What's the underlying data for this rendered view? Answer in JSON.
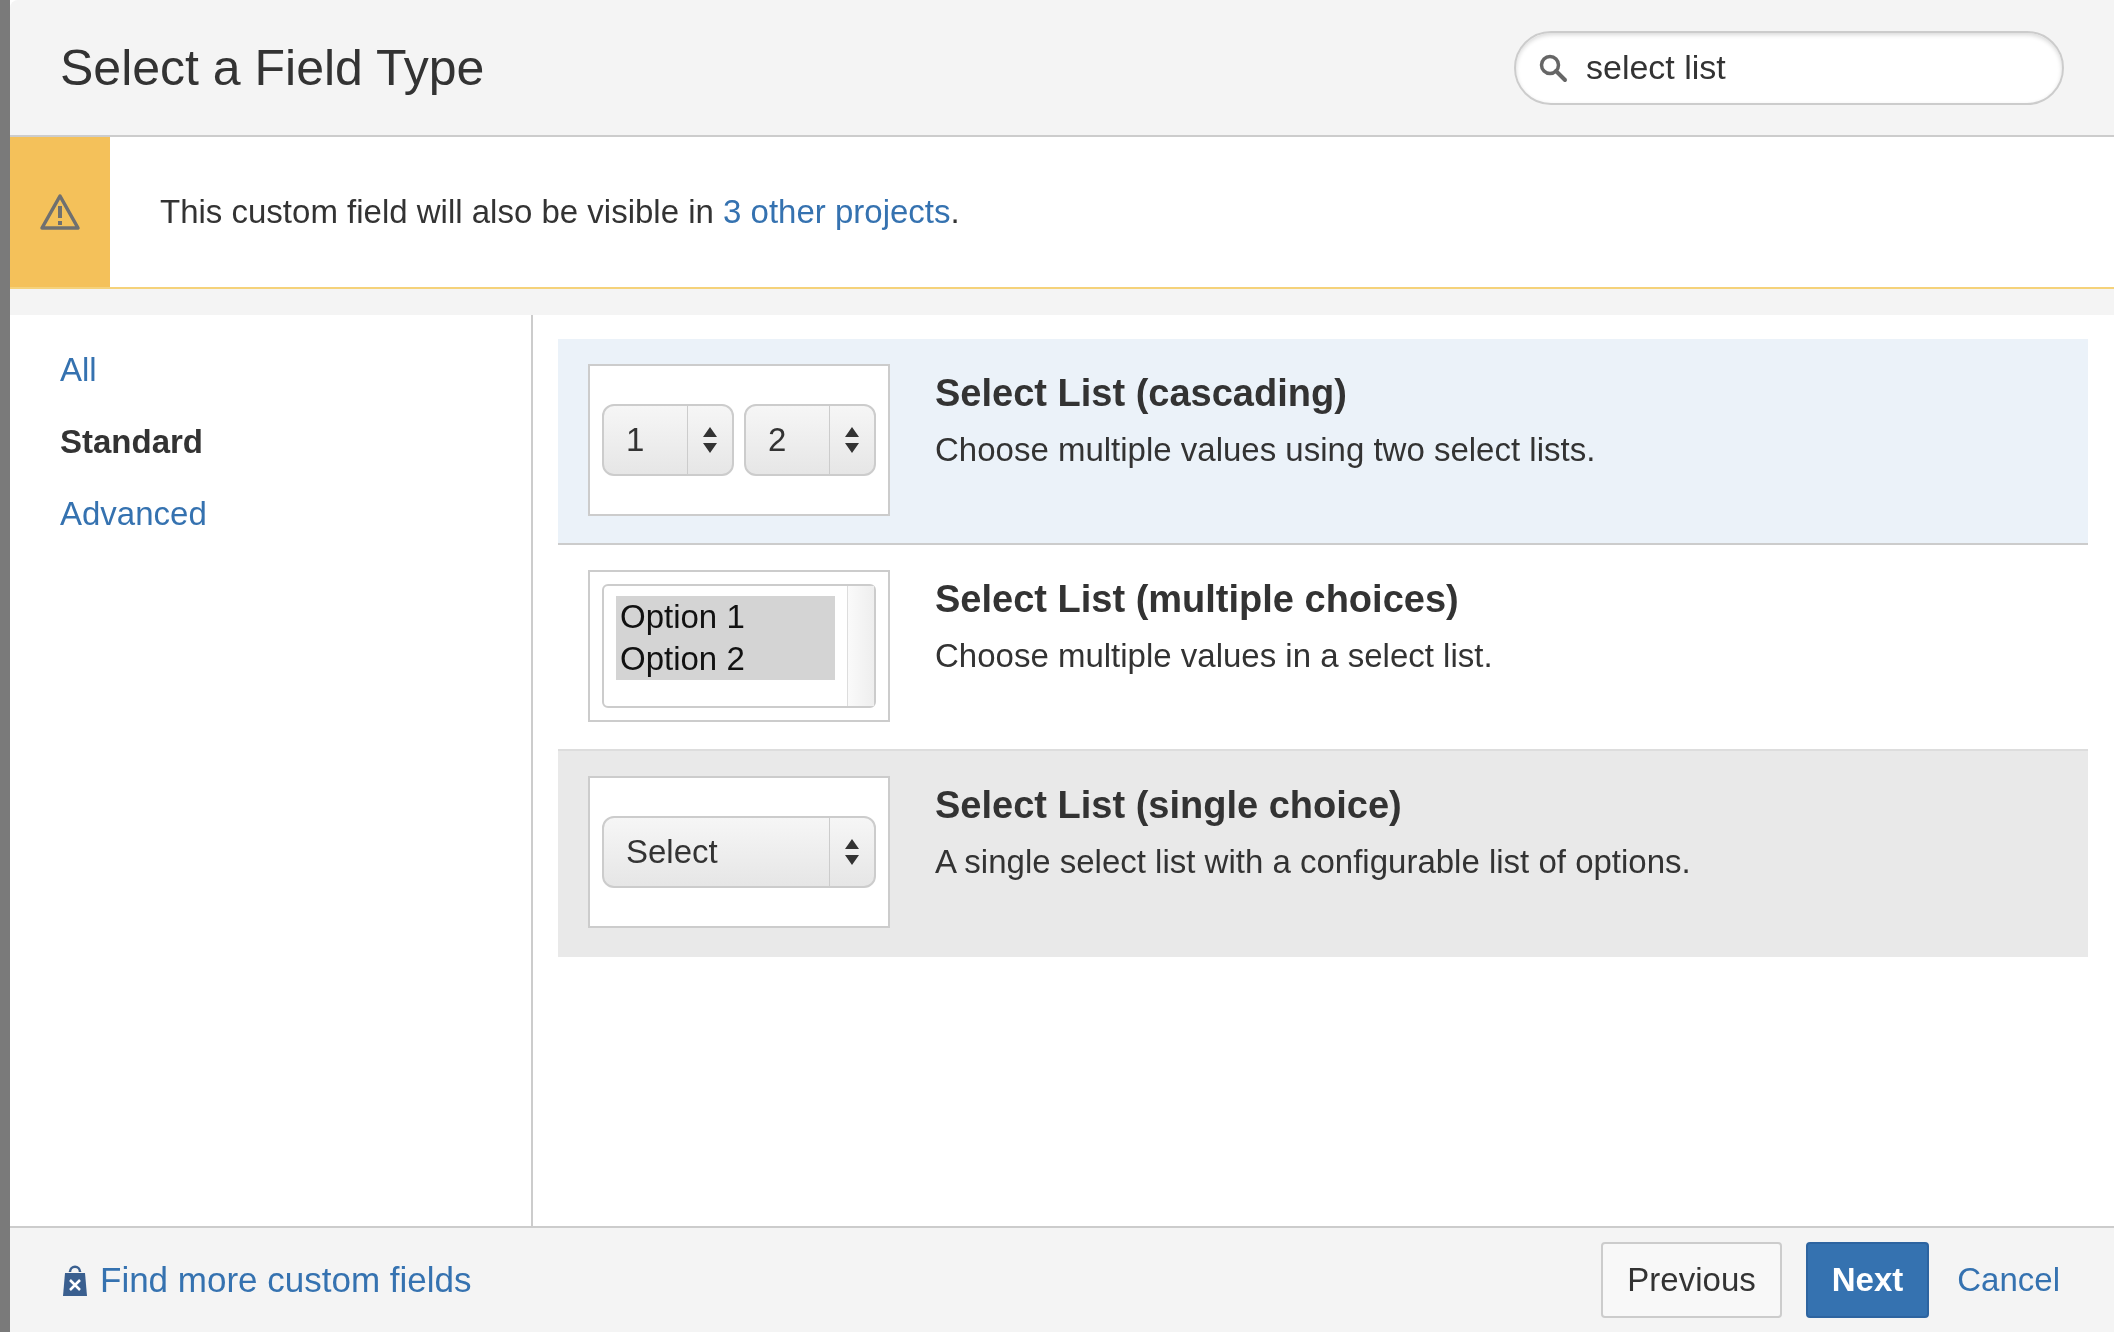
{
  "dialog": {
    "title": "Select a Field Type",
    "search": {
      "value": "select list"
    }
  },
  "warning": {
    "text": "This custom field will also be visible in ",
    "link": "3 other projects",
    "after": "."
  },
  "sidebar": {
    "items": [
      {
        "label": "All",
        "selected": false
      },
      {
        "label": "Standard",
        "selected": true
      },
      {
        "label": "Advanced",
        "selected": false
      }
    ]
  },
  "field_types": [
    {
      "kind": "cascading",
      "title": "Select List (cascading)",
      "description": "Choose multiple values using two select lists.",
      "preview": [
        "1",
        "2"
      ],
      "selected": true,
      "hovered": false
    },
    {
      "kind": "multi",
      "title": "Select List (multiple choices)",
      "description": "Choose multiple values in a select list.",
      "preview": [
        "Option 1",
        "Option 2"
      ],
      "selected": false,
      "hovered": false
    },
    {
      "kind": "single",
      "title": "Select List (single choice)",
      "description": "A single select list with a configurable list of options.",
      "preview": [
        "Select"
      ],
      "selected": false,
      "hovered": true
    }
  ],
  "footer": {
    "link": "Find more custom fields",
    "buttons": [
      {
        "label": "Previous",
        "kind": "secondary"
      },
      {
        "label": "Next",
        "kind": "primary"
      },
      {
        "label": "Cancel",
        "kind": "link"
      }
    ]
  }
}
